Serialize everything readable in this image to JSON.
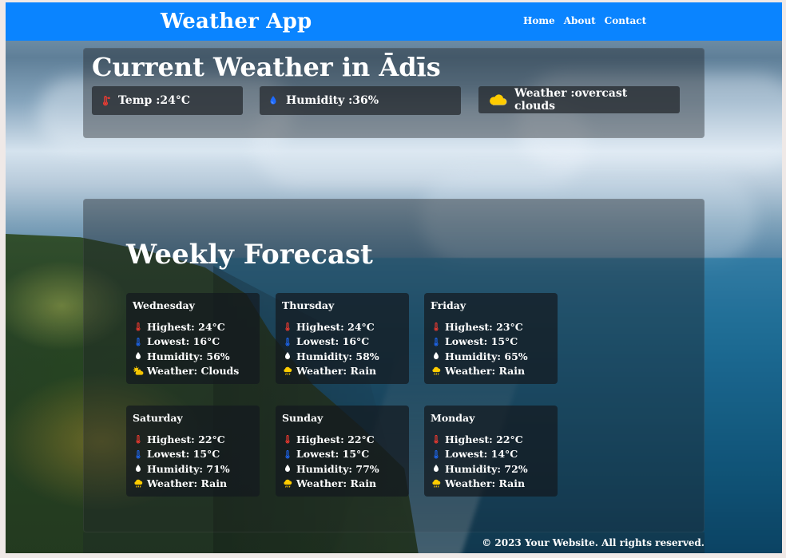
{
  "header": {
    "brand": "Weather App",
    "nav": [
      "Home",
      "About",
      "Contact"
    ]
  },
  "current": {
    "title": "Current Weather in Ādīs",
    "temp_text": "Temp :24°C",
    "humidity_text": "Humidity :36%",
    "weather_text": "Weather :overcast clouds",
    "icons": {
      "temp": "thermometer-icon",
      "humidity": "water-drop-icon",
      "weather": "cloud-icon"
    }
  },
  "forecast": {
    "title": "Weekly Forecast",
    "days": [
      {
        "day": "Wednesday",
        "highest": "Highest: 24°C",
        "lowest": "Lowest: 16°C",
        "humidity": "Humidity: 56%",
        "weather": "Weather: Clouds",
        "weather_icon": "partly-cloudy-icon"
      },
      {
        "day": "Thursday",
        "highest": "Highest: 24°C",
        "lowest": "Lowest: 16°C",
        "humidity": "Humidity: 58%",
        "weather": "Weather: Rain",
        "weather_icon": "rain-cloud-icon"
      },
      {
        "day": "Friday",
        "highest": "Highest: 23°C",
        "lowest": "Lowest: 15°C",
        "humidity": "Humidity: 65%",
        "weather": "Weather: Rain",
        "weather_icon": "rain-cloud-icon"
      },
      {
        "day": "Saturday",
        "highest": "Highest: 22°C",
        "lowest": "Lowest: 15°C",
        "humidity": "Humidity: 71%",
        "weather": "Weather: Rain",
        "weather_icon": "rain-cloud-icon"
      },
      {
        "day": "Sunday",
        "highest": "Highest: 22°C",
        "lowest": "Lowest: 15°C",
        "humidity": "Humidity: 77%",
        "weather": "Weather: Rain",
        "weather_icon": "rain-cloud-icon"
      },
      {
        "day": "Monday",
        "highest": "Highest: 22°C",
        "lowest": "Lowest: 14°C",
        "humidity": "Humidity: 72%",
        "weather": "Weather: Rain",
        "weather_icon": "rain-cloud-icon"
      }
    ]
  },
  "footer": {
    "text": "© 2023 Your Website. All rights reserved."
  },
  "colors": {
    "header_bg": "#0a84ff",
    "temp_red": "#ff3b30",
    "humidity_blue": "#1e6bff",
    "sun_yellow": "#ffcc00"
  }
}
